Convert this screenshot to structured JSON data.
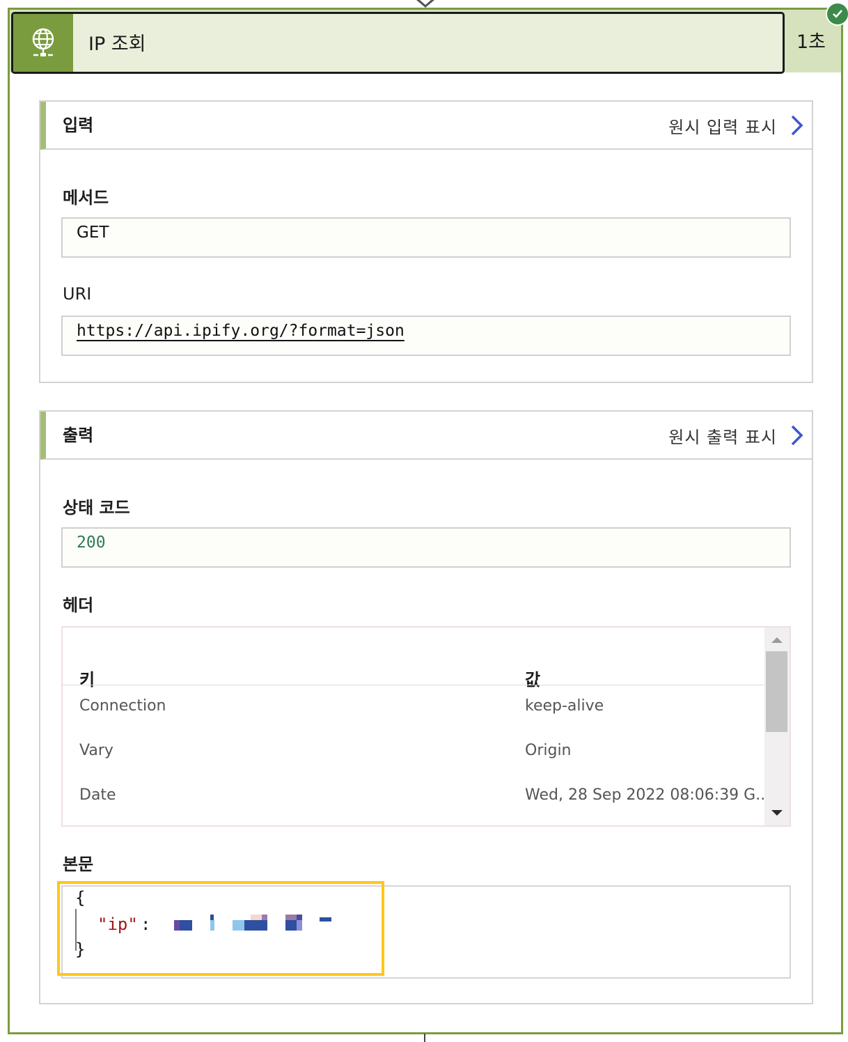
{
  "action": {
    "title": "IP 조회",
    "duration": "1초",
    "icon": "globe-network-icon",
    "status_icon": "check-icon",
    "accent_color": "#7a9c3f"
  },
  "inputs": {
    "title": "입력",
    "raw_link": "원시 입력 표시",
    "method": {
      "label": "메서드",
      "value": "GET"
    },
    "uri": {
      "label": "URI",
      "value": "https://api.ipify.org/?format=json"
    }
  },
  "outputs": {
    "title": "출력",
    "raw_link": "원시 출력 표시",
    "status_code": {
      "label": "상태 코드",
      "value": "200"
    },
    "headers": {
      "label": "헤더",
      "columns": [
        "키",
        "값"
      ],
      "rows": [
        {
          "key": "Connection",
          "value": "keep-alive"
        },
        {
          "key": "Vary",
          "value": "Origin"
        },
        {
          "key": "Date",
          "value": "Wed, 28 Sep 2022 08:06:39 G..."
        }
      ]
    },
    "body": {
      "label": "본문",
      "open_brace": "{",
      "key": "\"ip\"",
      "colon": ":",
      "close_brace": "}",
      "value_redacted": true
    }
  }
}
